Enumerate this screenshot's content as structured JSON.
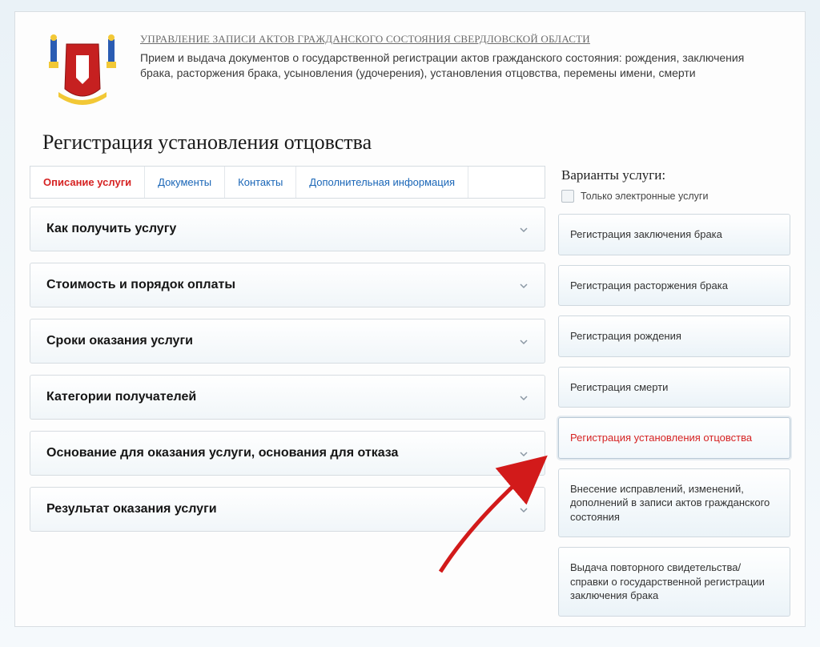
{
  "header": {
    "org_title": "УПРАВЛЕНИЕ ЗАПИСИ АКТОВ ГРАЖДАНСКОГО СОСТОЯНИЯ СВЕРДЛОВСКОЙ ОБЛАСТИ",
    "org_desc": "Прием и выдача документов о государственной регистрации актов гражданского состояния: рождения, заключения брака, расторжения брака, усыновления (удочерения), установления отцовства, перемены имени, смерти"
  },
  "page_title": "Регистрация установления отцовства",
  "tabs": [
    {
      "label": "Описание услуги",
      "active": true
    },
    {
      "label": "Документы",
      "active": false
    },
    {
      "label": "Контакты",
      "active": false
    },
    {
      "label": "Дополнительная информация",
      "active": false
    }
  ],
  "accordion": [
    {
      "label": "Как получить услугу"
    },
    {
      "label": "Стоимость и порядок оплаты"
    },
    {
      "label": "Сроки оказания услуги"
    },
    {
      "label": "Категории получателей"
    },
    {
      "label": "Основание для оказания услуги, основания для отказа"
    },
    {
      "label": "Результат оказания услуги"
    }
  ],
  "sidebar": {
    "title": "Варианты услуги:",
    "filter_label": "Только электронные услуги",
    "variants": [
      {
        "label": "Регистрация заключения брака",
        "active": false
      },
      {
        "label": "Регистрация расторжения брака",
        "active": false
      },
      {
        "label": "Регистрация рождения",
        "active": false
      },
      {
        "label": "Регистрация смерти",
        "active": false
      },
      {
        "label": "Регистрация установления отцовства",
        "active": true
      },
      {
        "label": "Внесение исправлений, изменений, дополнений в записи актов гражданского состояния",
        "active": false
      },
      {
        "label": "Выдача повторного свидетельства/справки о государственной регистрации заключения брака",
        "active": false
      }
    ]
  }
}
